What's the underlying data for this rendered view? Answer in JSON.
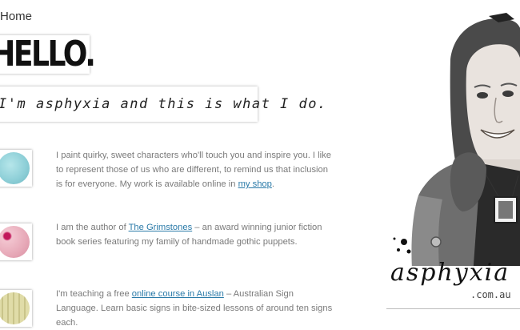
{
  "breadcrumb": "Home",
  "hello": "HELLO.",
  "tagline": "I'm asphyxia and this is what I do.",
  "items": [
    {
      "before": "I paint quirky, sweet characters who'll touch you and inspire you. I like to represent those of us who are different, to remind us that inclusion is for everyone. My work is available online in ",
      "link": "my shop",
      "after": ".",
      "thumb_color": "#8fd0d8",
      "thumb_icon": "painting-thumbnail"
    },
    {
      "before": "I am the author of ",
      "link": "The Grimstones",
      "after": " – an award winning junior fiction book series featuring my family of handmade gothic puppets.",
      "thumb_color": "#e7a9b8",
      "thumb_icon": "puppet-thumbnail"
    },
    {
      "before": "I'm teaching a free ",
      "link": "online course in Auslan",
      "after": " – Australian Sign Language. Learn basic signs in bite-sized lessons of around ten signs each.",
      "thumb_color": "#d6d29a",
      "thumb_icon": "sign-language-thumbnail"
    }
  ],
  "logo": {
    "name": "asphyxia",
    "domain": ".com.au"
  },
  "colors": {
    "link": "#2a7aa8",
    "body_text": "#7a7a7a"
  }
}
